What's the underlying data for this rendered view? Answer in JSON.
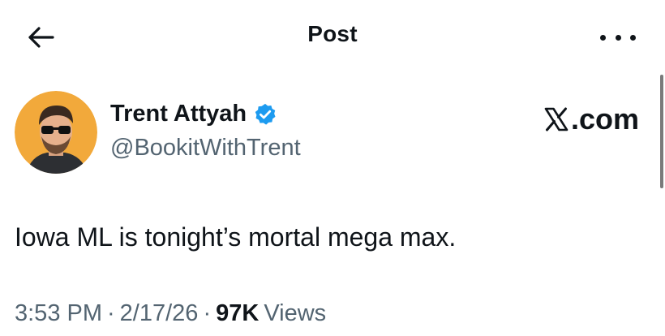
{
  "header": {
    "title": "Post",
    "back_icon": "arrow-left-icon",
    "more_icon": "more-horizontal-icon"
  },
  "author": {
    "name": "Trent Attyah",
    "handle": "@BookitWithTrent",
    "verified": true,
    "verified_color": "#1d9bf0",
    "avatar_bg": "#f2a93b"
  },
  "watermark": {
    "label": ".com",
    "logo": "x-logo-icon"
  },
  "tweet": {
    "text": "Iowa ML is tonight’s mortal mega max."
  },
  "meta": {
    "time": "3:53 PM",
    "separator": "·",
    "date": "2/17/26",
    "views_count": "97K",
    "views_label": "Views"
  }
}
